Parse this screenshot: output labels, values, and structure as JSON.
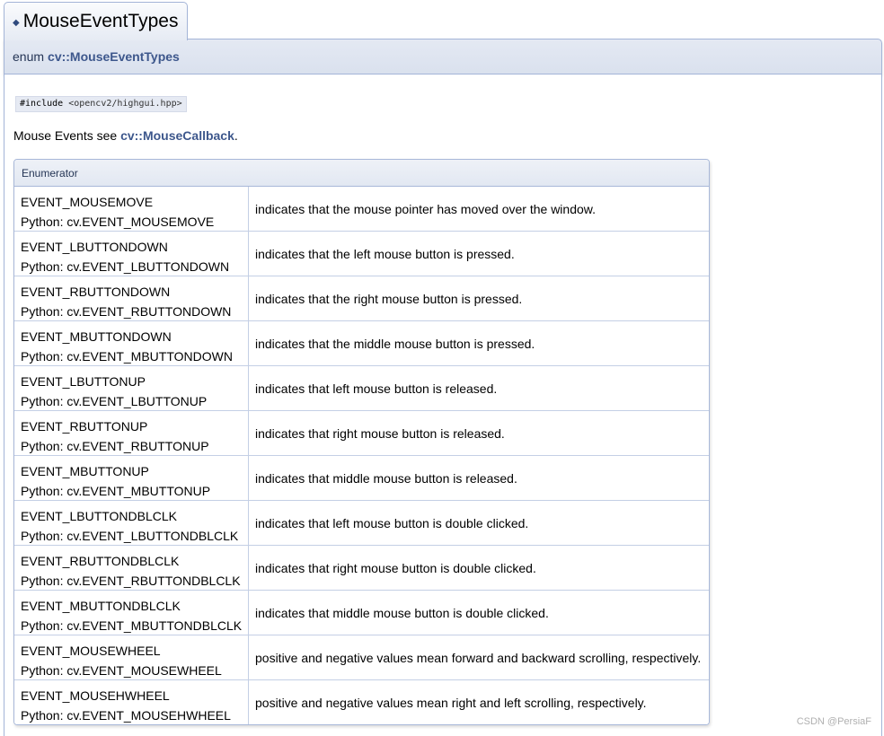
{
  "header": {
    "title": "MouseEventTypes",
    "prototype_keyword": "enum",
    "prototype_name": "cv::MouseEventTypes"
  },
  "include": {
    "directive": "#include",
    "file": "<opencv2/highgui.hpp>"
  },
  "description": {
    "prefix": "Mouse Events see",
    "link": "cv::MouseCallback",
    "suffix": "."
  },
  "enum_table": {
    "header": "Enumerator",
    "rows": [
      {
        "name": "EVENT_MOUSEMOVE",
        "python": "Python: cv.EVENT_MOUSEMOVE",
        "desc": "indicates that the mouse pointer has moved over the window."
      },
      {
        "name": "EVENT_LBUTTONDOWN",
        "python": "Python: cv.EVENT_LBUTTONDOWN",
        "desc": "indicates that the left mouse button is pressed."
      },
      {
        "name": "EVENT_RBUTTONDOWN",
        "python": "Python: cv.EVENT_RBUTTONDOWN",
        "desc": "indicates that the right mouse button is pressed."
      },
      {
        "name": "EVENT_MBUTTONDOWN",
        "python": "Python: cv.EVENT_MBUTTONDOWN",
        "desc": "indicates that the middle mouse button is pressed."
      },
      {
        "name": "EVENT_LBUTTONUP",
        "python": "Python: cv.EVENT_LBUTTONUP",
        "desc": "indicates that left mouse button is released."
      },
      {
        "name": "EVENT_RBUTTONUP",
        "python": "Python: cv.EVENT_RBUTTONUP",
        "desc": "indicates that right mouse button is released."
      },
      {
        "name": "EVENT_MBUTTONUP",
        "python": "Python: cv.EVENT_MBUTTONUP",
        "desc": "indicates that middle mouse button is released."
      },
      {
        "name": "EVENT_LBUTTONDBLCLK",
        "python": "Python: cv.EVENT_LBUTTONDBLCLK",
        "desc": "indicates that left mouse button is double clicked."
      },
      {
        "name": "EVENT_RBUTTONDBLCLK",
        "python": "Python: cv.EVENT_RBUTTONDBLCLK",
        "desc": "indicates that right mouse button is double clicked."
      },
      {
        "name": "EVENT_MBUTTONDBLCLK",
        "python": "Python: cv.EVENT_MBUTTONDBLCLK",
        "desc": "indicates that middle mouse button is double clicked."
      },
      {
        "name": "EVENT_MOUSEWHEEL",
        "python": "Python: cv.EVENT_MOUSEWHEEL",
        "desc": "positive and negative values mean forward and backward scrolling, respectively."
      },
      {
        "name": "EVENT_MOUSEHWHEEL",
        "python": "Python: cv.EVENT_MOUSEHWHEEL",
        "desc": "positive and negative values mean right and left scrolling, respectively."
      }
    ]
  },
  "watermark": "CSDN @PersiaF",
  "colors": {
    "link": "#3d578c",
    "border": "#a3b4d7",
    "header_bg": "#e2e8f2"
  }
}
